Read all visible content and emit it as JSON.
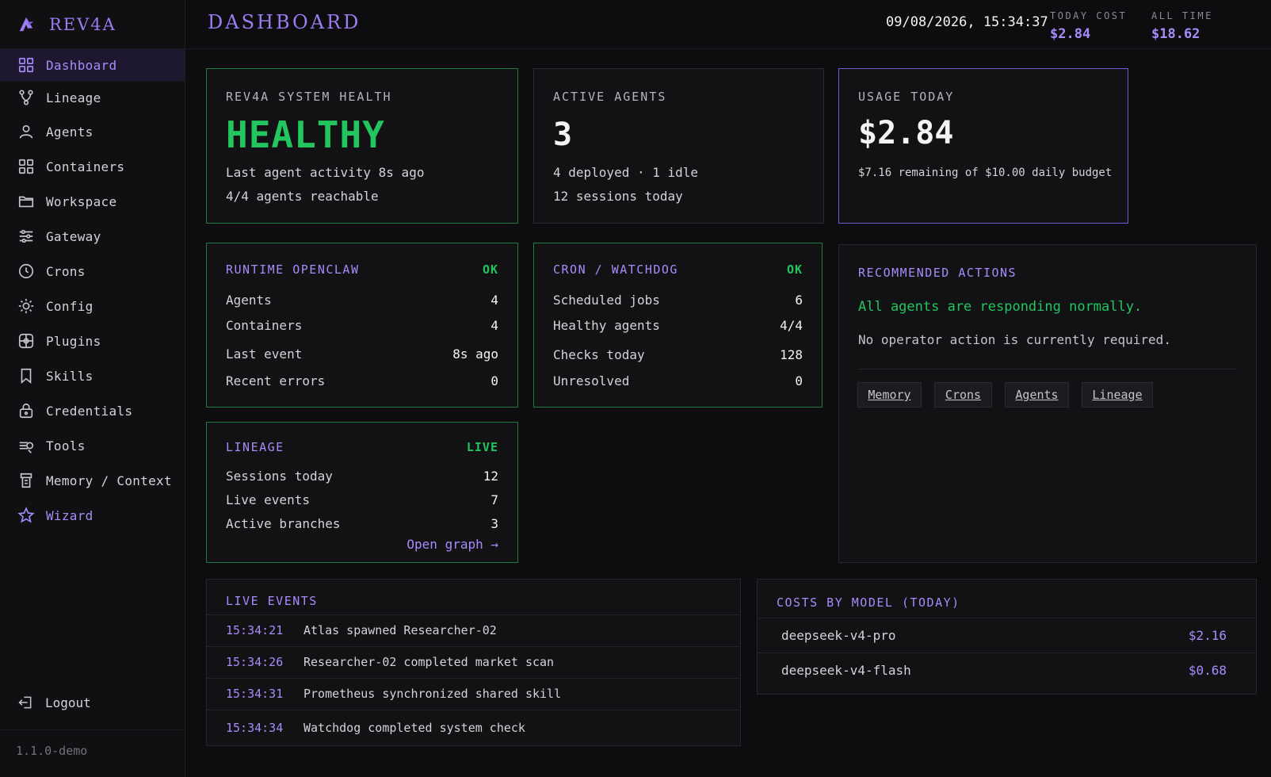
{
  "brand": {
    "name": "REV4A"
  },
  "nav": [
    {
      "label": "Dashboard",
      "icon": "grid-icon"
    },
    {
      "label": "Lineage",
      "icon": "branch-icon"
    },
    {
      "label": "Agents",
      "icon": "user-icon"
    },
    {
      "label": "Containers",
      "icon": "grid-icon"
    },
    {
      "label": "Workspace",
      "icon": "folder-icon"
    },
    {
      "label": "Gateway",
      "icon": "sliders-icon"
    },
    {
      "label": "Crons",
      "icon": "clock-icon"
    },
    {
      "label": "Config",
      "icon": "sun-icon"
    },
    {
      "label": "Plugins",
      "icon": "plugin-icon"
    },
    {
      "label": "Skills",
      "icon": "bookmark-icon"
    },
    {
      "label": "Credentials",
      "icon": "lock-icon"
    },
    {
      "label": "Tools",
      "icon": "tools-icon"
    },
    {
      "label": "Memory / Context",
      "icon": "memory-icon"
    },
    {
      "label": "Wizard",
      "icon": "star-icon"
    }
  ],
  "logout_label": "Logout",
  "version": "1.1.0-demo",
  "header": {
    "title": "DASHBOARD",
    "datetime": "09/08/2026, 15:34:37",
    "today_cost_label": "TODAY COST",
    "today_cost": "$2.84",
    "all_time_label": "ALL TIME",
    "all_time": "$18.62"
  },
  "health": {
    "label": "REV4A SYSTEM HEALTH",
    "status": "HEALTHY",
    "line1": "Last agent activity 8s ago",
    "line2": "4/4 agents reachable"
  },
  "active_agents": {
    "label": "ACTIVE AGENTS",
    "count": "3",
    "line1": "4 deployed · 1 idle",
    "line2": "12 sessions today"
  },
  "usage": {
    "label": "USAGE TODAY",
    "amount": "$2.84",
    "line1": "$7.16 remaining of $10.00 daily budget"
  },
  "runtime": {
    "title": "RUNTIME OPENCLAW",
    "status": "OK",
    "rows": [
      {
        "k": "Agents",
        "v": "4"
      },
      {
        "k": "Containers",
        "v": "4"
      },
      {
        "k": "Last event",
        "v": "8s ago"
      },
      {
        "k": "Recent errors",
        "v": "0"
      }
    ]
  },
  "cron": {
    "title": "CRON / WATCHDOG",
    "status": "OK",
    "rows": [
      {
        "k": "Scheduled jobs",
        "v": "6"
      },
      {
        "k": "Healthy agents",
        "v": "4/4"
      },
      {
        "k": "Checks today",
        "v": "128"
      },
      {
        "k": "Unresolved",
        "v": "0"
      }
    ]
  },
  "lineage": {
    "title": "LINEAGE",
    "status": "LIVE",
    "rows": [
      {
        "k": "Sessions today",
        "v": "12"
      },
      {
        "k": "Live events",
        "v": "7"
      },
      {
        "k": "Active branches",
        "v": "3"
      }
    ],
    "link": "Open graph →"
  },
  "recommended": {
    "title": "RECOMMENDED ACTIONS",
    "headline": "All agents are responding normally.",
    "text": "No operator action is currently required.",
    "chips": [
      "Memory",
      "Crons",
      "Agents",
      "Lineage"
    ]
  },
  "live_events": {
    "title": "LIVE EVENTS",
    "items": [
      {
        "t": "15:34:21",
        "m": "Atlas spawned Researcher-02"
      },
      {
        "t": "15:34:26",
        "m": "Researcher-02 completed market scan"
      },
      {
        "t": "15:34:31",
        "m": "Prometheus synchronized shared skill"
      },
      {
        "t": "15:34:34",
        "m": "Watchdog completed system check"
      }
    ]
  },
  "costs": {
    "title": "COSTS BY MODEL (TODAY)",
    "items": [
      {
        "model": "deepseek-v4-pro",
        "cost": "$2.16"
      },
      {
        "model": "deepseek-v4-flash",
        "cost": "$0.68"
      }
    ]
  },
  "colors": {
    "accent": "#a78bfa",
    "ok": "#22c55e",
    "background": "#0d0d0f"
  }
}
